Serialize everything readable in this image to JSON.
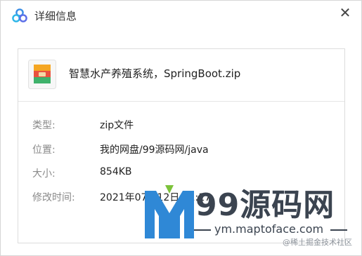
{
  "window": {
    "title": "详细信息",
    "close_label": "✕"
  },
  "file": {
    "name": "智慧水产养殖系统，SpringBoot.zip"
  },
  "details": [
    {
      "label": "类型:",
      "value": "zip文件"
    },
    {
      "label": "位置:",
      "value": "我的网盘/99源码网/java"
    },
    {
      "label": "大小:",
      "value": "854KB"
    },
    {
      "label": "修改时间:",
      "value": "2021年07月12日 11:17"
    }
  ],
  "watermark": {
    "brand": "99源码网",
    "url": "ym.maptoface.com",
    "community": "@稀土掘金技术社区"
  },
  "colors": {
    "watermark": "#3b4450",
    "m_blue": "#2f88d6",
    "m_green": "#7cc23a"
  }
}
